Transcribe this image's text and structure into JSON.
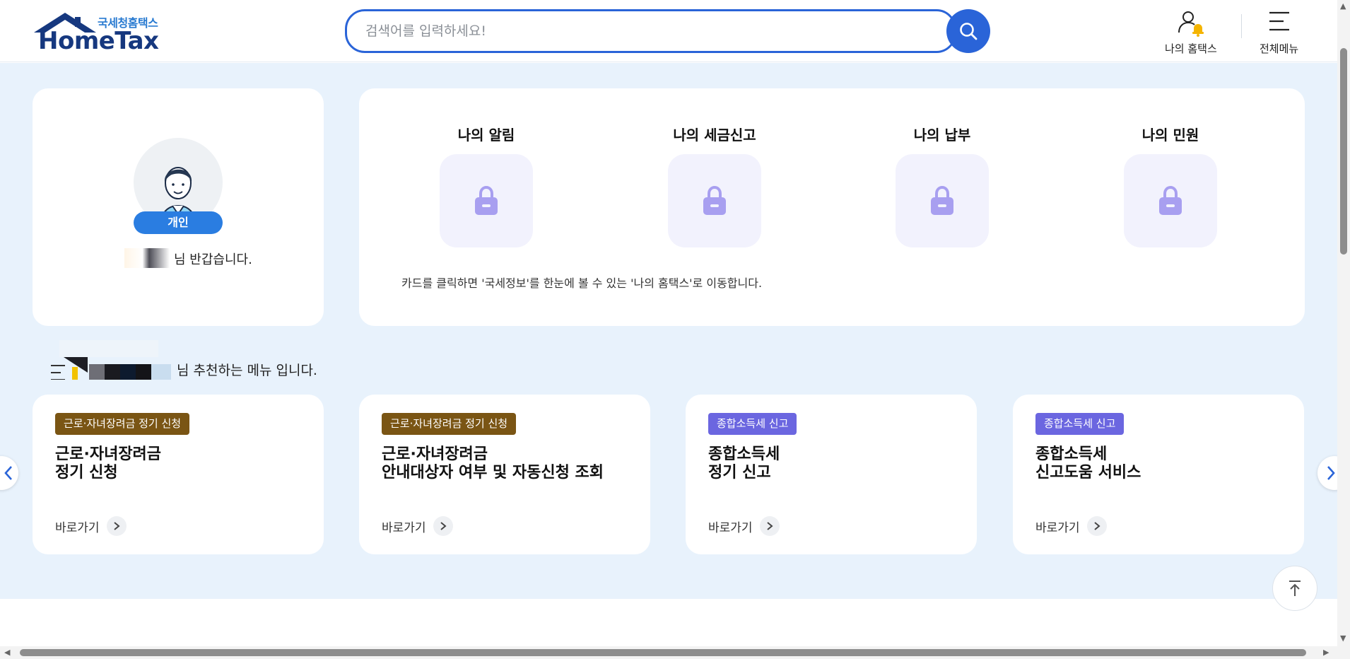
{
  "header": {
    "logo_sub": "국세청홈택스",
    "logo_main": "HomeTax",
    "search_placeholder": "검색어를 입력하세요!",
    "my_hometax_label": "나의 홈택스",
    "all_menu_label": "전체메뉴"
  },
  "profile": {
    "badge": "개인",
    "greeting": "님 반갑습니다."
  },
  "my_section": {
    "items": [
      {
        "label": "나의 알림",
        "icon": "lock-icon"
      },
      {
        "label": "나의 세금신고",
        "icon": "lock-icon"
      },
      {
        "label": "나의 납부",
        "icon": "lock-icon"
      },
      {
        "label": "나의 민원",
        "icon": "lock-icon"
      }
    ],
    "note": "카드를 클릭하면 '국세정보'를 한눈에 볼 수 있는 '나의 홈택스'로 이동합니다."
  },
  "recommend": {
    "title": "님 추천하는 메뉴 입니다.",
    "cards": [
      {
        "tag": "근로·자녀장려금 정기 신청",
        "tag_color": "#7a5514",
        "title_line1": "근로·자녀장려금",
        "title_line2": "정기 신청",
        "go": "바로가기"
      },
      {
        "tag": "근로·자녀장려금 정기 신청",
        "tag_color": "#7a5514",
        "title_line1": "근로·자녀장려금",
        "title_line2": "안내대상자 여부 및 자동신청 조회",
        "go": "바로가기"
      },
      {
        "tag": "종합소득세 신고",
        "tag_color": "#6b66e0",
        "title_line1": "종합소득세",
        "title_line2": "정기 신고",
        "go": "바로가기"
      },
      {
        "tag": "종합소득세 신고",
        "tag_color": "#6b66e0",
        "title_line1": "종합소득세",
        "title_line2": "신고도움 서비스",
        "go": "바로가기"
      }
    ]
  },
  "colors": {
    "primary": "#2a64d8",
    "navy": "#16387f",
    "background": "#e8f2fc",
    "lock": "#a89ff0"
  }
}
